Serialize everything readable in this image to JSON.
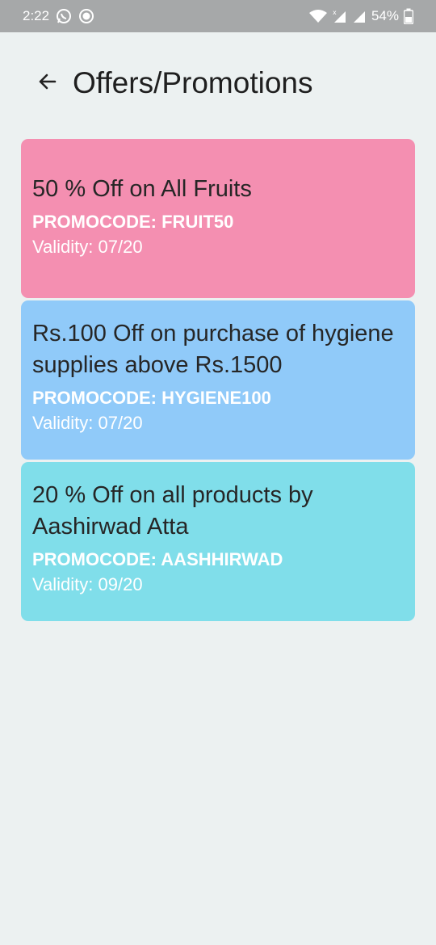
{
  "status_bar": {
    "time": "2:22",
    "battery": "54%",
    "icons": [
      "whatsapp-icon",
      "record-icon",
      "wifi-icon",
      "signal-icon",
      "signal-icon",
      "battery-icon"
    ]
  },
  "header": {
    "title": "Offers/Promotions",
    "back_icon": "arrow-left-icon"
  },
  "offers": [
    {
      "title": "50 % Off on All Fruits",
      "promo": "PROMOCODE: FRUIT50",
      "validity": "Validity: 07/20",
      "color": "#f48fb1"
    },
    {
      "title": "Rs.100 Off on purchase of hygiene supplies above Rs.1500",
      "promo": "PROMOCODE: HYGIENE100",
      "validity": "Validity: 07/20",
      "color": "#90caf9"
    },
    {
      "title": "20 % Off on all products by Aashirwad Atta",
      "promo": "PROMOCODE: AASHHIRWAD",
      "validity": "Validity: 09/20",
      "color": "#80deea"
    }
  ]
}
